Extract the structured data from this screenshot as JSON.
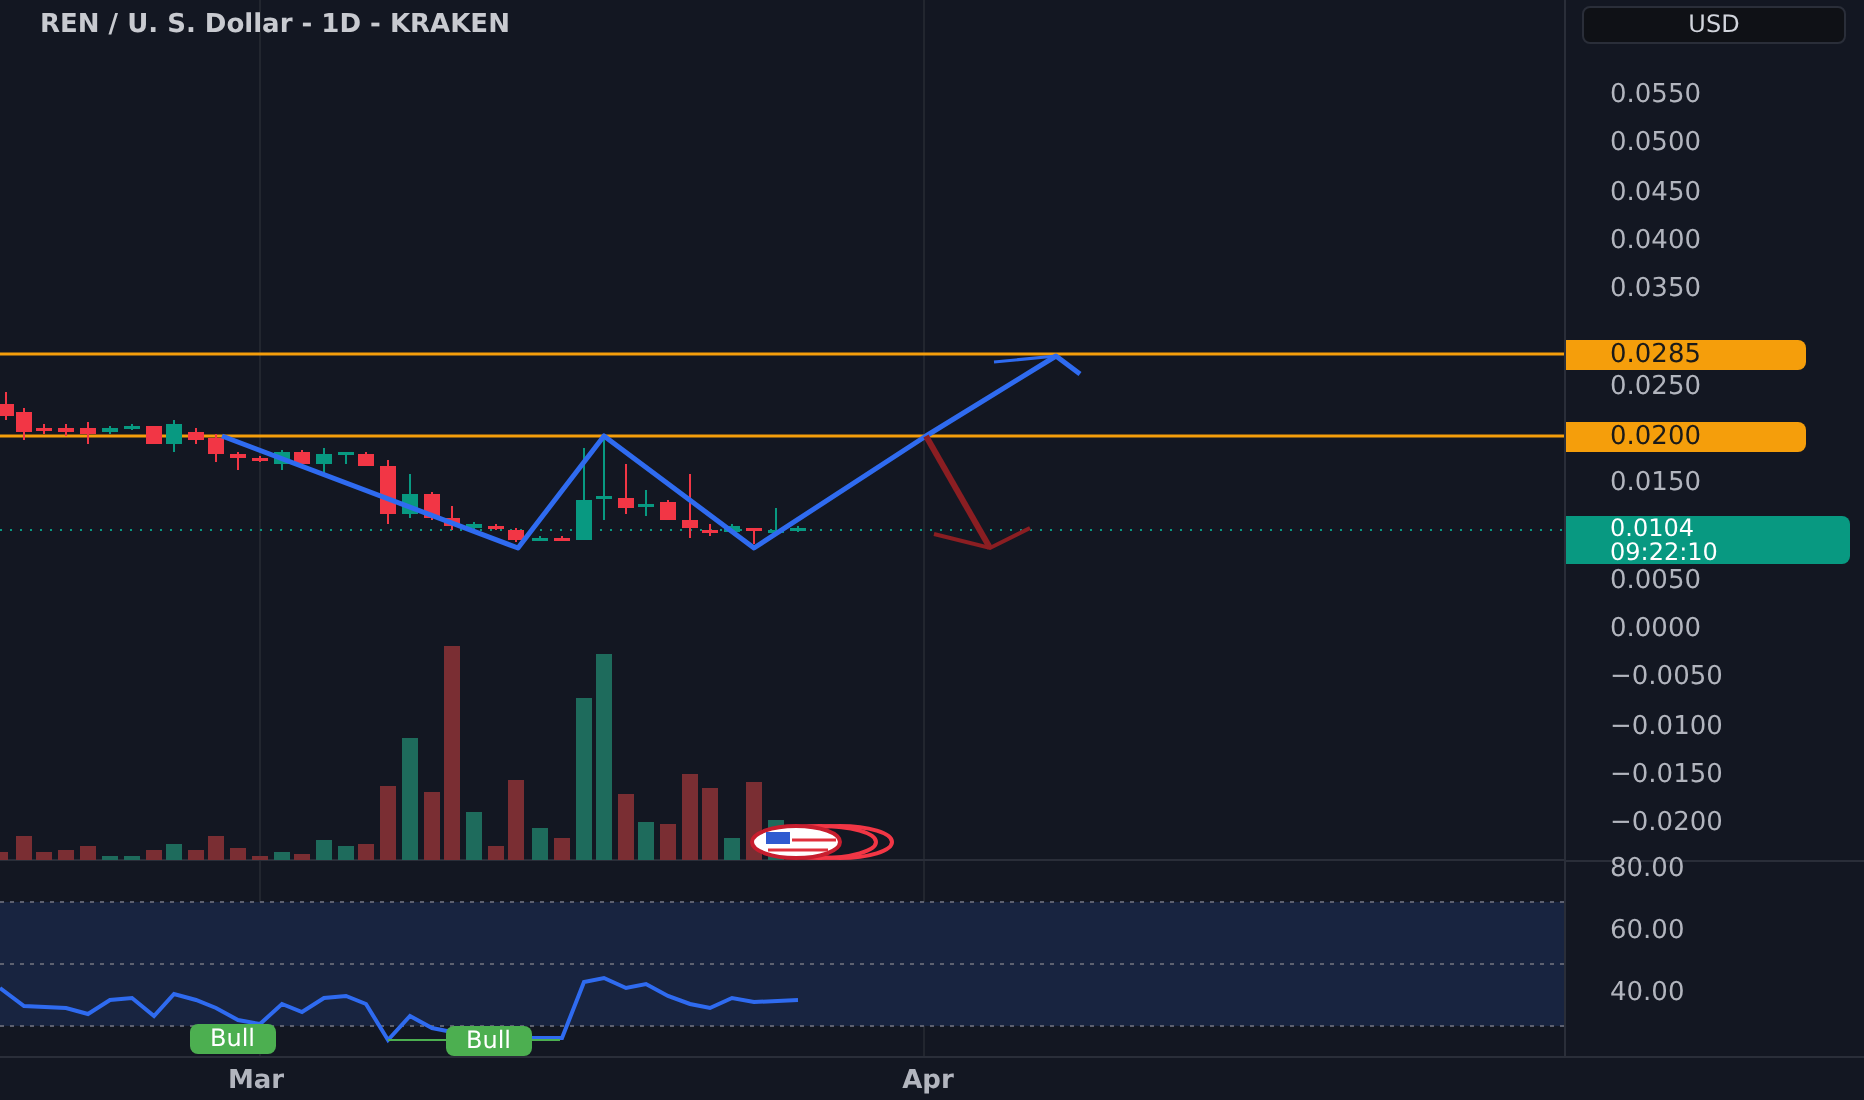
{
  "title": "REN / U. S. Dollar - 1D - KRAKEN",
  "currency_button": "USD",
  "price_axis": [
    "0.0550",
    "0.0500",
    "0.0450",
    "0.0400",
    "0.0350",
    "0.0250",
    "0.0150",
    "0.0050",
    "0.0000",
    "−0.0050",
    "−0.0100",
    "−0.0150",
    "−0.0200"
  ],
  "levels": [
    {
      "label": "0.0285"
    },
    {
      "label": "0.0200"
    }
  ],
  "last_price": {
    "label": "0.0104",
    "countdown": "09:22:10"
  },
  "rsi_axis": [
    "80.00",
    "60.00",
    "40.00"
  ],
  "signals": [
    {
      "label": "Bull"
    },
    {
      "label": "Bull"
    }
  ],
  "time_axis": [
    "Mar",
    "Apr"
  ]
}
